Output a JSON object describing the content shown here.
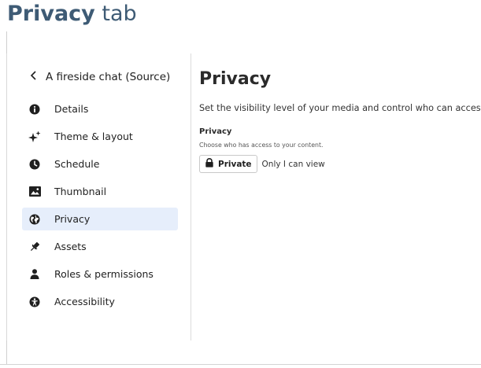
{
  "doc_heading": {
    "bold": "Privacy",
    "rest": " tab"
  },
  "sidebar": {
    "back_label": "A fireside chat (Source)",
    "items": [
      {
        "label": "Details",
        "icon": "info-icon",
        "active": false
      },
      {
        "label": "Theme & layout",
        "icon": "sparkle-icon",
        "active": false
      },
      {
        "label": "Schedule",
        "icon": "clock-icon",
        "active": false
      },
      {
        "label": "Thumbnail",
        "icon": "image-icon",
        "active": false
      },
      {
        "label": "Privacy",
        "icon": "globe-icon",
        "active": true
      },
      {
        "label": "Assets",
        "icon": "pin-icon",
        "active": false
      },
      {
        "label": "Roles & permissions",
        "icon": "person-icon",
        "active": false
      },
      {
        "label": "Accessibility",
        "icon": "accessibility-icon",
        "active": false
      }
    ]
  },
  "main": {
    "title": "Privacy",
    "description": "Set the visibility level of your media and control who can access it.",
    "section_label": "Privacy",
    "section_sub": "Choose who has access to your content.",
    "privacy_button_label": "Private",
    "privacy_note": "Only I can view"
  },
  "colors": {
    "heading": "#3e5b75",
    "active_bg": "#e6eefb",
    "text": "#1f1f1f"
  }
}
